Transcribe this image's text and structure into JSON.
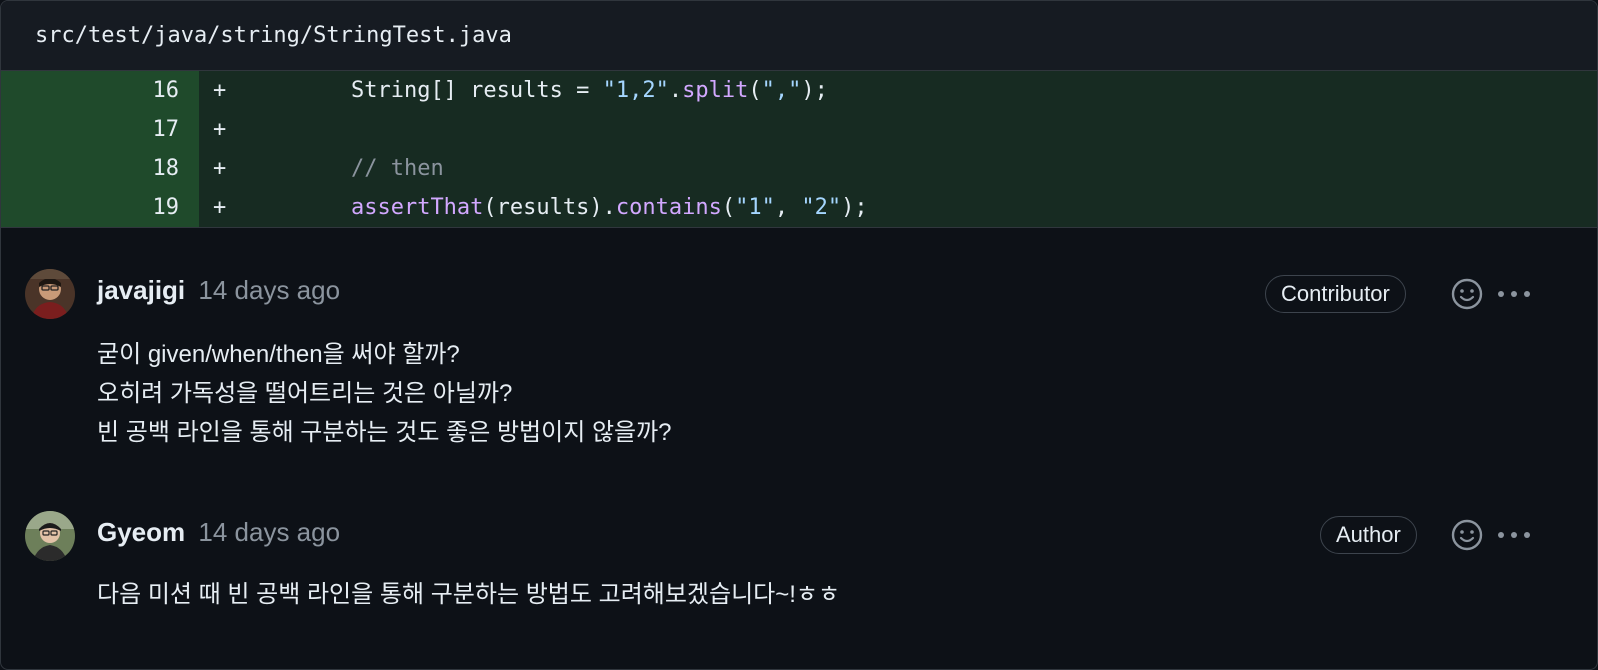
{
  "file": {
    "path": "src/test/java/string/StringTest.java"
  },
  "diff_lines": [
    {
      "num": "16",
      "marker": "+",
      "indent": "        ",
      "segments": [
        {
          "t": "String[] results = ",
          "c": "code-text"
        },
        {
          "t": "\"1,2\"",
          "c": "c-str"
        },
        {
          "t": ".",
          "c": "code-text"
        },
        {
          "t": "split",
          "c": "c-fn"
        },
        {
          "t": "(",
          "c": "code-text"
        },
        {
          "t": "\",\"",
          "c": "c-str"
        },
        {
          "t": ");",
          "c": "code-text"
        }
      ]
    },
    {
      "num": "17",
      "marker": "+",
      "indent": "",
      "segments": []
    },
    {
      "num": "18",
      "marker": "+",
      "indent": "        ",
      "segments": [
        {
          "t": "// then",
          "c": "c-cmt"
        }
      ]
    },
    {
      "num": "19",
      "marker": "+",
      "indent": "        ",
      "segments": [
        {
          "t": "assertThat",
          "c": "c-fn"
        },
        {
          "t": "(results).",
          "c": "code-text"
        },
        {
          "t": "contains",
          "c": "c-fn"
        },
        {
          "t": "(",
          "c": "code-text"
        },
        {
          "t": "\"1\"",
          "c": "c-str"
        },
        {
          "t": ", ",
          "c": "code-text"
        },
        {
          "t": "\"2\"",
          "c": "c-str"
        },
        {
          "t": ");",
          "c": "code-text"
        }
      ]
    }
  ],
  "comments": [
    {
      "author": "javajigi",
      "time": "14 days ago",
      "badge": "Contributor",
      "body": [
        "굳이 given/when/then을 써야 할까?",
        "오히려 가독성을 떨어트리는 것은 아닐까?",
        "빈 공백 라인을 통해 구분하는 것도 좋은 방법이지 않을까?"
      ]
    },
    {
      "author": "Gyeom",
      "time": "14 days ago",
      "badge": "Author",
      "body": [
        "다음 미션 때 빈 공백 라인을 통해 구분하는 방법도 고려해보겠습니다~!ㅎㅎ"
      ]
    }
  ],
  "icons": {
    "reaction": "smiley-icon",
    "more": "kebab-horizontal-icon"
  },
  "colors": {
    "background": "#0d1117",
    "diff_added_num_bg": "#1f4a2b",
    "diff_added_code_bg": "#172b22",
    "string": "#a5d6ff",
    "function": "#d2a8ff",
    "comment": "#8b949e",
    "muted": "#8b949e"
  }
}
